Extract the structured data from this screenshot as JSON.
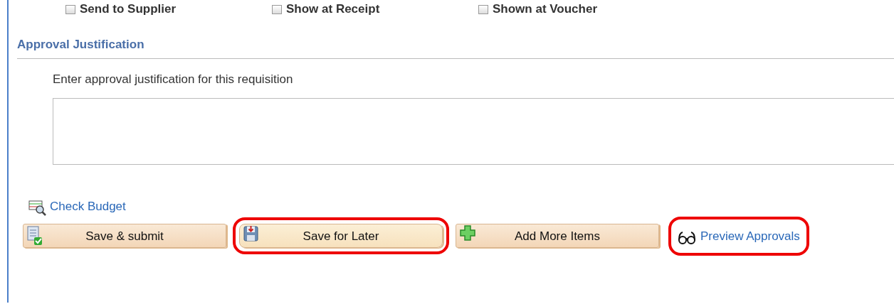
{
  "options": [
    {
      "label": "Send to Supplier",
      "checked": false
    },
    {
      "label": "Show at Receipt",
      "checked": false
    },
    {
      "label": "Shown at Voucher",
      "checked": false
    }
  ],
  "section": {
    "title": "Approval Justification",
    "prompt": "Enter approval justification for this requisition"
  },
  "check_budget": {
    "label": "Check Budget"
  },
  "actions": [
    {
      "kind": "button",
      "label": "Save & submit",
      "highlighted": false
    },
    {
      "kind": "button",
      "label": "Save for Later",
      "highlighted": true
    },
    {
      "kind": "button",
      "label": "Add More Items",
      "highlighted": false
    },
    {
      "kind": "link",
      "label": "Preview Approvals",
      "highlighted": true
    }
  ]
}
